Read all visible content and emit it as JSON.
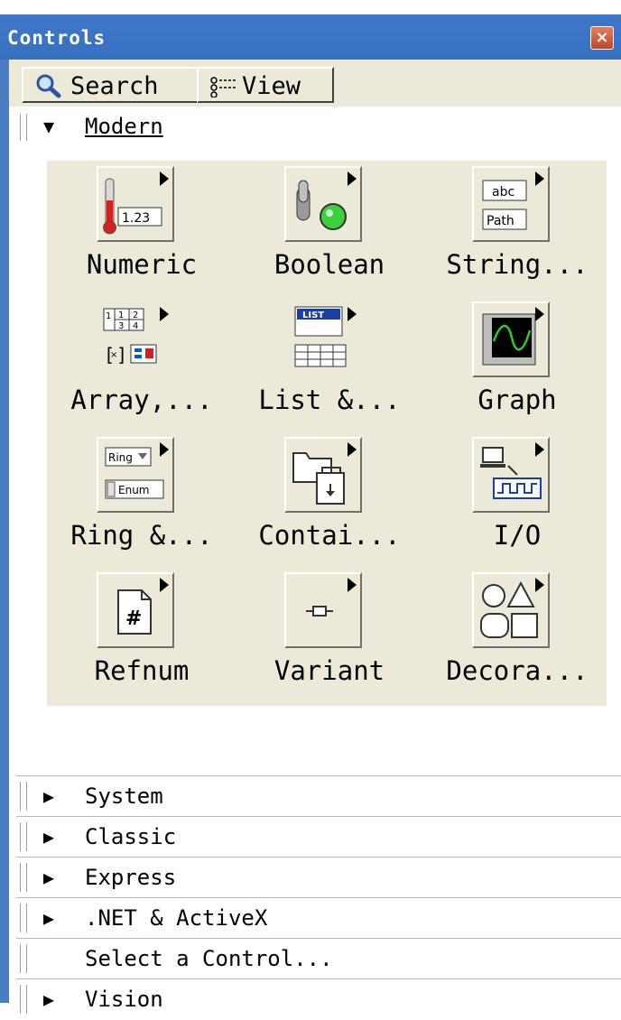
{
  "window": {
    "title": "Controls",
    "close_label": "×"
  },
  "toolbar": {
    "search_label": "Search",
    "view_label": "View"
  },
  "modern": {
    "label": "Modern",
    "tiles": [
      {
        "label": "Numeric",
        "icon": "numeric-icon"
      },
      {
        "label": "Boolean",
        "icon": "boolean-icon"
      },
      {
        "label": "String...",
        "icon": "string-path-icon"
      },
      {
        "label": "Array,...",
        "icon": "array-cluster-icon"
      },
      {
        "label": "List &...",
        "icon": "list-table-icon"
      },
      {
        "label": "Graph",
        "icon": "graph-icon"
      },
      {
        "label": "Ring &...",
        "icon": "ring-enum-icon"
      },
      {
        "label": "Contai...",
        "icon": "containers-icon"
      },
      {
        "label": "I/O",
        "icon": "io-icon"
      },
      {
        "label": "Refnum",
        "icon": "refnum-icon"
      },
      {
        "label": "Variant",
        "icon": "variant-icon"
      },
      {
        "label": "Decora...",
        "icon": "decorations-icon"
      }
    ],
    "icon_text": {
      "numeric_value": "1.23",
      "abc": "abc",
      "path": "Path",
      "list": "LIST",
      "ring": "Ring",
      "enum": "Enum"
    }
  },
  "categories": [
    {
      "label": "System",
      "has_arrow": true
    },
    {
      "label": "Classic",
      "has_arrow": true
    },
    {
      "label": "Express",
      "has_arrow": true
    },
    {
      "label": ".NET & ActiveX",
      "has_arrow": true
    },
    {
      "label": "Select a Control...",
      "has_arrow": false
    },
    {
      "label": "Vision",
      "has_arrow": true
    }
  ],
  "colors": {
    "title_bar": "#3670c0",
    "palette_bg": "#ece9d8",
    "close_button": "#c3432a"
  }
}
